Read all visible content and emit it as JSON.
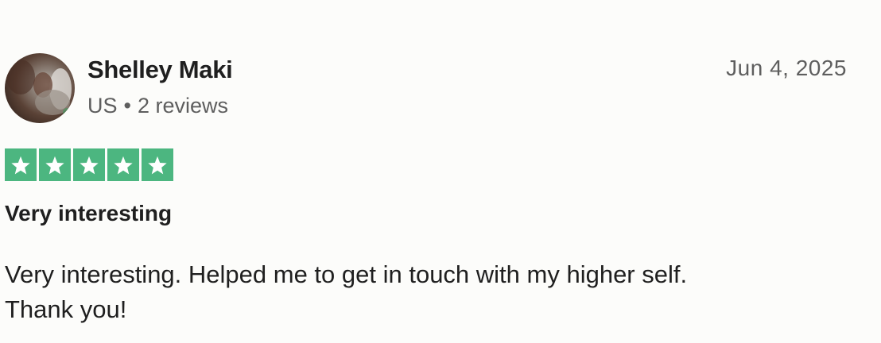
{
  "reviewer": {
    "name": "Shelley Maki",
    "country": "US",
    "separator": "•",
    "reviews_count": "2 reviews"
  },
  "review": {
    "date": "Jun 4, 2025",
    "rating": 5,
    "rating_max": 5,
    "title": "Very interesting",
    "body_lines": [
      "Very interesting. Helped me to get in touch with my higher self.",
      "Thank you!"
    ]
  },
  "colors": {
    "star_background": "#4cb680",
    "star_fill": "#ffffff",
    "page_background": "#fcfcfa",
    "meta_text": "#5e5e5e"
  },
  "icons": {
    "star": "star-icon",
    "avatar": "user-avatar-photo"
  }
}
